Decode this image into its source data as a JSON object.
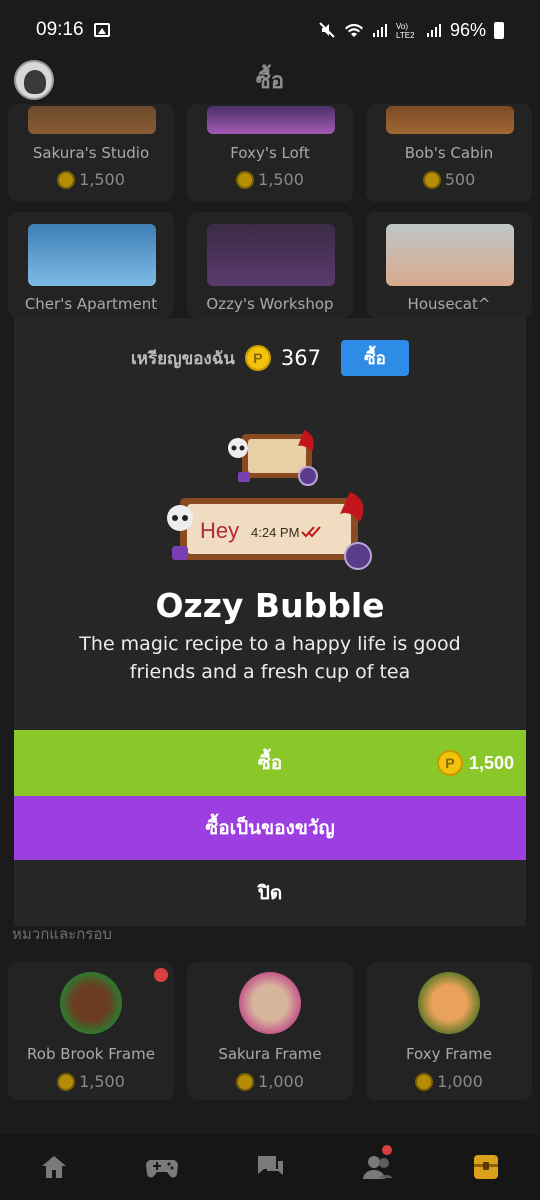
{
  "status": {
    "time": "09:16",
    "battery": "96%"
  },
  "header": {
    "title": "ซื้อ"
  },
  "shop_rows": [
    [
      {
        "name": "Sakura's Studio",
        "price": "1,500"
      },
      {
        "name": "Foxy's Loft",
        "price": "1,500"
      },
      {
        "name": "Bob's Cabin",
        "price": "500"
      }
    ],
    [
      {
        "name": "Cher's Apartment"
      },
      {
        "name": "Ozzy's Workshop"
      },
      {
        "name": "Housecat^"
      }
    ]
  ],
  "section_title": "หมวกและกรอบ",
  "frames": [
    {
      "name": "Rob Brook Frame",
      "price": "1,500"
    },
    {
      "name": "Sakura Frame",
      "price": "1,000"
    },
    {
      "name": "Foxy Frame",
      "price": "1,000"
    }
  ],
  "modal": {
    "coin_label": "เหรียญของฉัน",
    "coin_count": "367",
    "buy_coins_label": "ซื้อ",
    "preview_text": "Hey",
    "preview_time": "4:24 PM",
    "product_name": "Ozzy Bubble",
    "description": "The magic recipe to a happy life is good friends and a fresh cup of tea",
    "buy_label": "ซื้อ",
    "price": "1,500",
    "gift_label": "ซื้อเป็นของขวัญ",
    "close_label": "ปิด"
  },
  "icons": {
    "coin": "P",
    "nav": [
      "home-icon",
      "gamepad-icon",
      "chat-icon",
      "friends-icon",
      "shop-icon"
    ]
  },
  "colors": {
    "buy_green": "#8ac829",
    "gift_purple": "#9c3ee0",
    "coin_blue": "#2f8ce6",
    "coin_gold": "#f2c20c",
    "nav_active": "#d9a21a"
  }
}
